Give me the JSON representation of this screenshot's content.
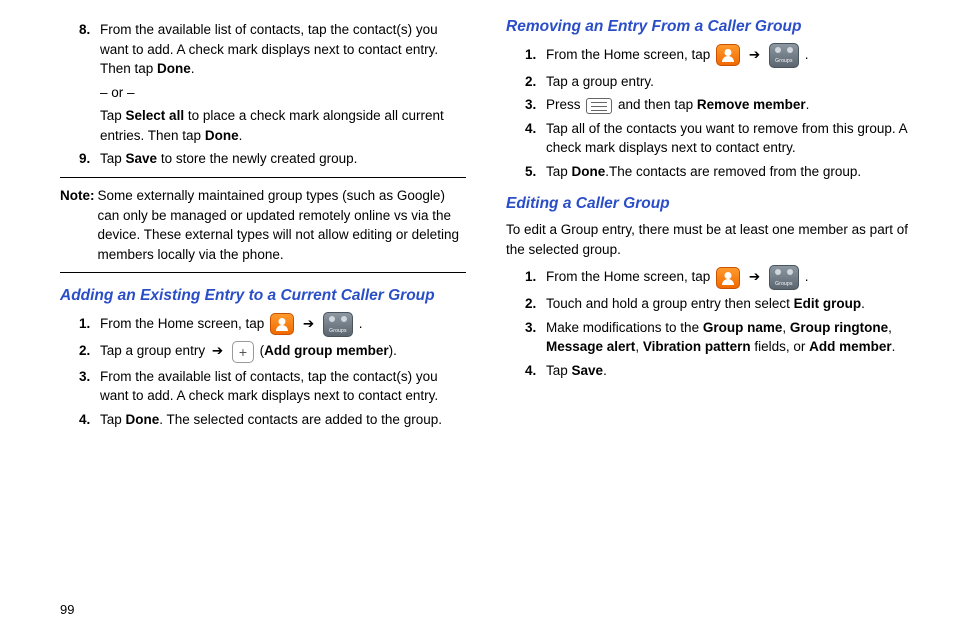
{
  "left": {
    "steps_a": [
      {
        "num": "8",
        "parts": [
          "From the available list of contacts, tap the contact(s) you want to add. A check mark displays next to contact entry. Then tap ",
          "Done",
          "."
        ],
        "sub1": "– or –",
        "sub2": [
          "Tap ",
          "Select all",
          " to place a check mark alongside all current entries. Then tap ",
          "Done",
          "."
        ]
      },
      {
        "num": "9",
        "parts": [
          "Tap ",
          "Save",
          " to store the newly created group."
        ]
      }
    ],
    "note_label": "Note:",
    "note_body": "Some externally maintained group types (such as Google) can only be managed or updated remotely online vs via the device. These external types will not allow editing or deleting members locally via the phone.",
    "heading_b": "Adding an Existing Entry to a Current Caller Group",
    "steps_b": [
      {
        "num": "1",
        "pre": "From the Home screen, tap ",
        "post": "."
      },
      {
        "num": "2",
        "pre": "Tap a group entry ",
        "arrow": "➔",
        "plus_label": " (",
        "bold": "Add group member",
        "tail": ")."
      },
      {
        "num": "3",
        "text": "From the available list of contacts, tap the contact(s) you want to add. A check mark displays next to contact entry."
      },
      {
        "num": "4",
        "parts": [
          "Tap ",
          "Done",
          ". The selected contacts are added to the group."
        ]
      }
    ]
  },
  "right": {
    "heading_c": "Removing an Entry From a Caller Group",
    "steps_c": [
      {
        "num": "1",
        "pre": "From the Home screen, tap ",
        "post": "."
      },
      {
        "num": "2",
        "text": "Tap a group entry."
      },
      {
        "num": "3",
        "pre": "Press ",
        "post_text": " and then tap ",
        "bold": "Remove member",
        "tail": "."
      },
      {
        "num": "4",
        "text": "Tap all of the contacts you want to remove from this group. A check mark displays next to contact entry."
      },
      {
        "num": "5",
        "parts": [
          "Tap ",
          "Done",
          ".The contacts are removed from the group."
        ]
      }
    ],
    "heading_d": "Editing a Caller Group",
    "intro_d": "To edit a Group entry, there must be at least one member as part of the selected group.",
    "steps_d": [
      {
        "num": "1",
        "pre": "From the Home screen, tap ",
        "post": "."
      },
      {
        "num": "2",
        "parts": [
          "Touch and hold a group entry then select ",
          "Edit group",
          "."
        ]
      },
      {
        "num": "3",
        "parts": [
          "Make modifications to the ",
          "Group name",
          ", ",
          "Group ringtone",
          ", ",
          "Message alert",
          ", ",
          "Vibration pattern",
          " fields, or ",
          "Add member",
          "."
        ]
      },
      {
        "num": "4",
        "parts": [
          "Tap ",
          "Save",
          "."
        ]
      }
    ]
  },
  "arrow": "➔",
  "page_number": "99"
}
